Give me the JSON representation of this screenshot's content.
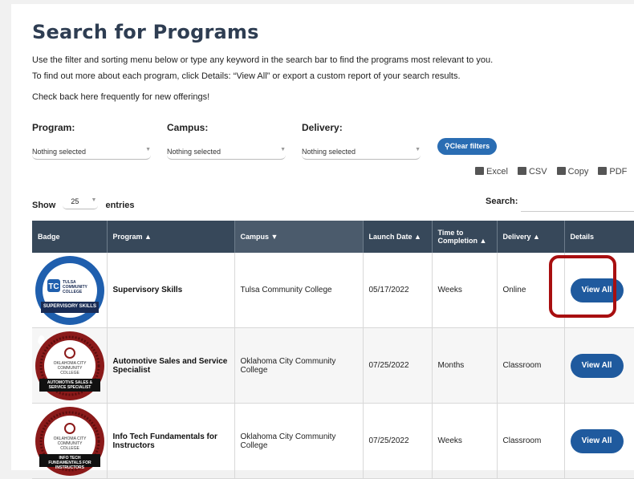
{
  "header": {
    "title": "Search for Programs",
    "intro1": "Use the filter and sorting menu below or type any keyword in the search bar to find the programs most relevant to you.",
    "intro2": "To find out more about each program, click Details: “View All” or export a custom report of your search results.",
    "intro3": "Check back here frequently for new offerings!"
  },
  "filters": {
    "program": {
      "label": "Program:",
      "value": "Nothing selected"
    },
    "campus": {
      "label": "Campus:",
      "value": "Nothing selected"
    },
    "delivery": {
      "label": "Delivery:",
      "value": "Nothing selected"
    },
    "clear_label": "Clear filters"
  },
  "exports": [
    "Excel",
    "CSV",
    "Copy",
    "PDF"
  ],
  "length": {
    "show": "Show",
    "value": "25",
    "entries": "entries"
  },
  "search": {
    "label": "Search:"
  },
  "table": {
    "headers": [
      "Badge",
      "Program",
      "Campus",
      "Launch Date",
      "Time to Completion",
      "Delivery",
      "Details"
    ],
    "rows": [
      {
        "badge_text": "SUPERVISORY SKILLS",
        "badge_org": "TULSA COMMUNITY COLLEGE",
        "program": "Supervisory Skills",
        "campus": "Tulsa Community College",
        "launch": "05/17/2022",
        "time": "Weeks",
        "delivery": "Online",
        "details": "View All"
      },
      {
        "badge_text": "AUTOMOTIVE SALES & SERVICE SPECIALIST",
        "badge_org": "OKLAHOMA CITY COMMUNITY COLLEGE",
        "program": "Automotive Sales and Service Specialist",
        "campus": "Oklahoma City Community College",
        "launch": "07/25/2022",
        "time": "Months",
        "delivery": "Classroom",
        "details": "View All"
      },
      {
        "badge_text": "INFO TECH FUNDAMENTALS FOR INSTRUCTORS",
        "badge_org": "OKLAHOMA CITY COMMUNITY COLLEGE",
        "program": "Info Tech Fundamentals for Instructors",
        "campus": "Oklahoma City Community College",
        "launch": "07/25/2022",
        "time": "Weeks",
        "delivery": "Classroom",
        "details": "View All"
      }
    ]
  },
  "colors": {
    "header_bg": "#37485a",
    "button": "#1f5a9e",
    "highlight": "#a80f10",
    "tcc_badge": "#1f5fae",
    "occc_badge": "#8b1a1a"
  }
}
